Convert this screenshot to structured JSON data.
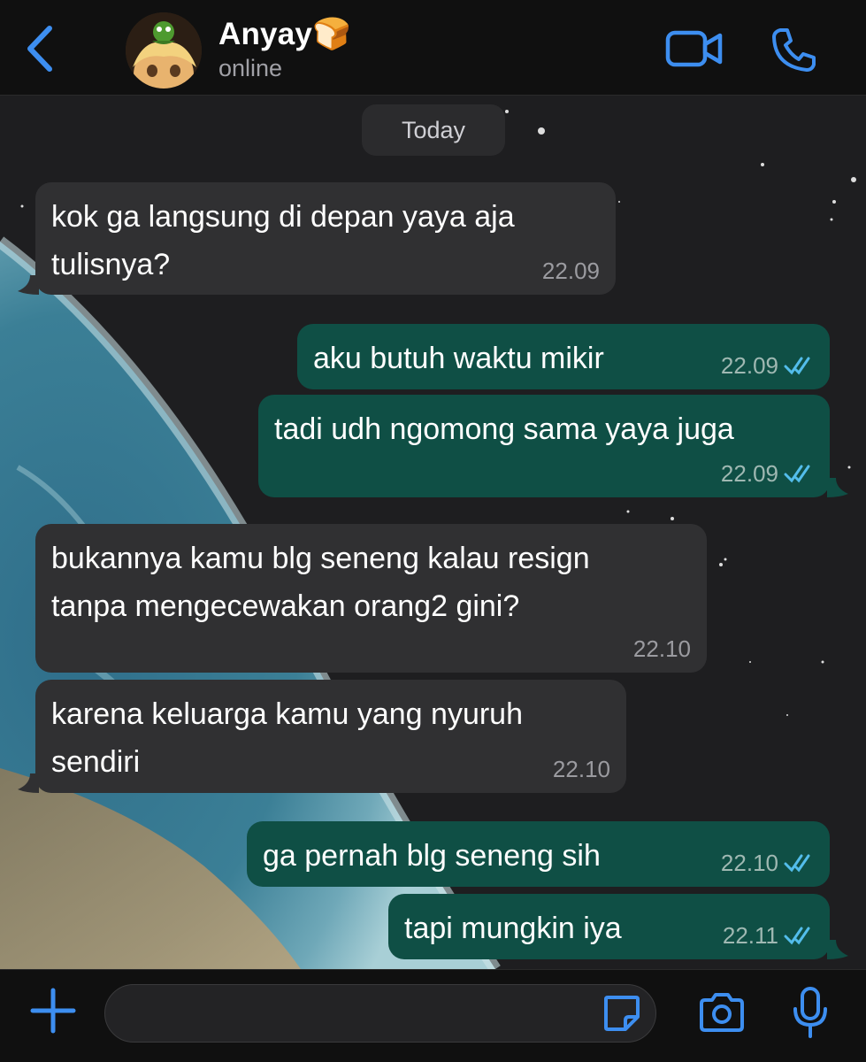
{
  "header": {
    "contact_name": "Anyay🍞",
    "status": "online",
    "icons": {
      "back": "chevron-left-icon",
      "video": "video-camera-icon",
      "call": "phone-icon"
    }
  },
  "chat": {
    "date_label": "Today",
    "messages": [
      {
        "direction": "incoming",
        "lines": [
          "kok ga langsung di depan yaya aja",
          "tulisnya?"
        ],
        "time": "22.09"
      },
      {
        "direction": "outgoing",
        "lines": [
          "aku butuh waktu mikir"
        ],
        "time": "22.09",
        "status": "read"
      },
      {
        "direction": "outgoing",
        "lines": [
          "tadi udh ngomong sama yaya juga"
        ],
        "time": "22.09",
        "status": "read"
      },
      {
        "direction": "incoming",
        "lines": [
          "bukannya kamu blg seneng kalau resign",
          "tanpa mengecewakan orang2 gini?"
        ],
        "time": "22.10"
      },
      {
        "direction": "incoming",
        "lines": [
          "karena keluarga kamu yang nyuruh",
          "sendiri"
        ],
        "time": "22.10"
      },
      {
        "direction": "outgoing",
        "lines": [
          "ga pernah blg seneng sih"
        ],
        "time": "22.10",
        "status": "read"
      },
      {
        "direction": "outgoing",
        "lines": [
          "tapi mungkin iya"
        ],
        "time": "22.11",
        "status": "read"
      }
    ]
  },
  "composer": {
    "input_value": "",
    "icons": {
      "attach": "plus-icon",
      "sticker": "sticker-icon",
      "camera": "camera-icon",
      "mic": "microphone-icon"
    }
  },
  "colors": {
    "accent": "#3d8ef0",
    "incoming_bubble": "#303032",
    "outgoing_bubble": "#0f4f45",
    "read_tick": "#53bdeb"
  }
}
